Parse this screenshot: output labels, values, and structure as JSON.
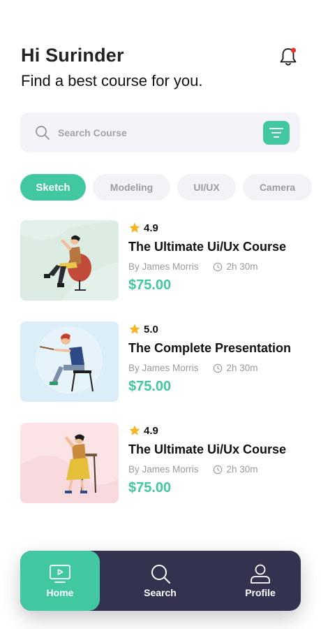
{
  "header": {
    "greeting": "Hi Surinder",
    "subtitle": "Find a best course for you."
  },
  "icons": {
    "notification": "bell-icon",
    "search": "search-icon",
    "filter": "filter-icon",
    "star": "star-icon",
    "clock": "clock-icon",
    "home": "tv-icon",
    "profile": "user-icon"
  },
  "search": {
    "placeholder": "Search Course"
  },
  "categories": [
    {
      "label": "Sketch",
      "active": true
    },
    {
      "label": "Modeling",
      "active": false
    },
    {
      "label": "UI/UX",
      "active": false
    },
    {
      "label": "Camera",
      "active": false
    }
  ],
  "courses": [
    {
      "rating": "4.9",
      "title": "The Ultimate Ui/Ux Course",
      "author": "By James Morris",
      "duration": "2h 30m",
      "price": "$75.00"
    },
    {
      "rating": "5.0",
      "title": "The Complete Presentation",
      "author": "By James Morris",
      "duration": "2h 30m",
      "price": "$75.00"
    },
    {
      "rating": "4.9",
      "title": "The Ultimate Ui/Ux Course",
      "author": "By James Morris",
      "duration": "2h 30m",
      "price": "$75.00"
    }
  ],
  "nav": {
    "items": [
      {
        "label": "Home",
        "active": true
      },
      {
        "label": "Search",
        "active": false
      },
      {
        "label": "Profile",
        "active": false
      }
    ]
  },
  "colors": {
    "accent": "#41c7a1",
    "nav_bg": "#33334f",
    "notification_dot": "#e8322f"
  }
}
